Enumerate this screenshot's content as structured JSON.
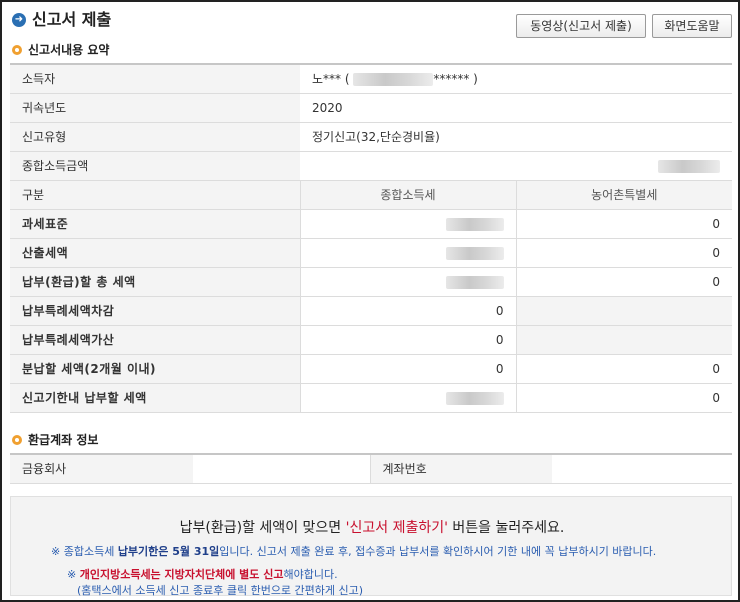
{
  "header": {
    "title": "신고서 제출",
    "btn_video": "동영상(신고서 제출)",
    "btn_help": "화면도움말"
  },
  "summary": {
    "section_title": "신고서내용 요약",
    "rows": [
      {
        "label": "소득자",
        "value_prefix": "노*** (  ",
        "value_suffix": "******  )"
      },
      {
        "label": "귀속년도",
        "value": "2020"
      },
      {
        "label": "신고유형",
        "value": "정기신고(32,단순경비율)"
      },
      {
        "label": "종합소득금액",
        "value": ""
      }
    ],
    "header_row": {
      "label": "구분",
      "col1": "종합소득세",
      "col2": "농어촌특별세"
    },
    "tax_rows": [
      {
        "label": "과세표준",
        "col1": "",
        "col2": "0"
      },
      {
        "label": "산출세액",
        "col1": "",
        "col2": "0"
      },
      {
        "label": "납부(환급)할 총 세액",
        "col1": "",
        "col2": "0"
      },
      {
        "label": "납부특례세액차감",
        "col1": "0",
        "col2": ""
      },
      {
        "label": "납부특례세액가산",
        "col1": "0",
        "col2": ""
      },
      {
        "label": "분납할 세액(2개월 이내)",
        "col1": "0",
        "col2": "0"
      },
      {
        "label": "신고기한내 납부할 세액",
        "col1": "",
        "col2": "0"
      }
    ]
  },
  "refund": {
    "section_title": "환급계좌 정보",
    "bank_label": "금융회사",
    "bank_value": "",
    "account_label": "계좌번호",
    "account_value": ""
  },
  "notice": {
    "main_prefix": "납부(환급)할 세액이 맞으면 ",
    "main_red": "'신고서 제출하기'",
    "main_suffix": " 버튼을 눌러주세요.",
    "l1_a": "※ 종합소득세 ",
    "l1_b": "납부기한은 5월 31일",
    "l1_c": "입니다. 신고서 제출 완료 후, 접수증과 납부서를 확인하시어 기한 내에 꼭 납부하시기 바랍니다.",
    "l2_a": "※ ",
    "l2_b": "개인지방소득세는 지방자치단체에 별도 신고",
    "l2_c": "해야합니다.",
    "l3": "(홈택스에서 소득세 신고 종료후 클릭 한번으로 간편하게 신고)"
  },
  "colors": {
    "accent": "#2a6fb3",
    "bullet": "#f0a030",
    "red": "#c8102e",
    "blue": "#2a5db0"
  }
}
